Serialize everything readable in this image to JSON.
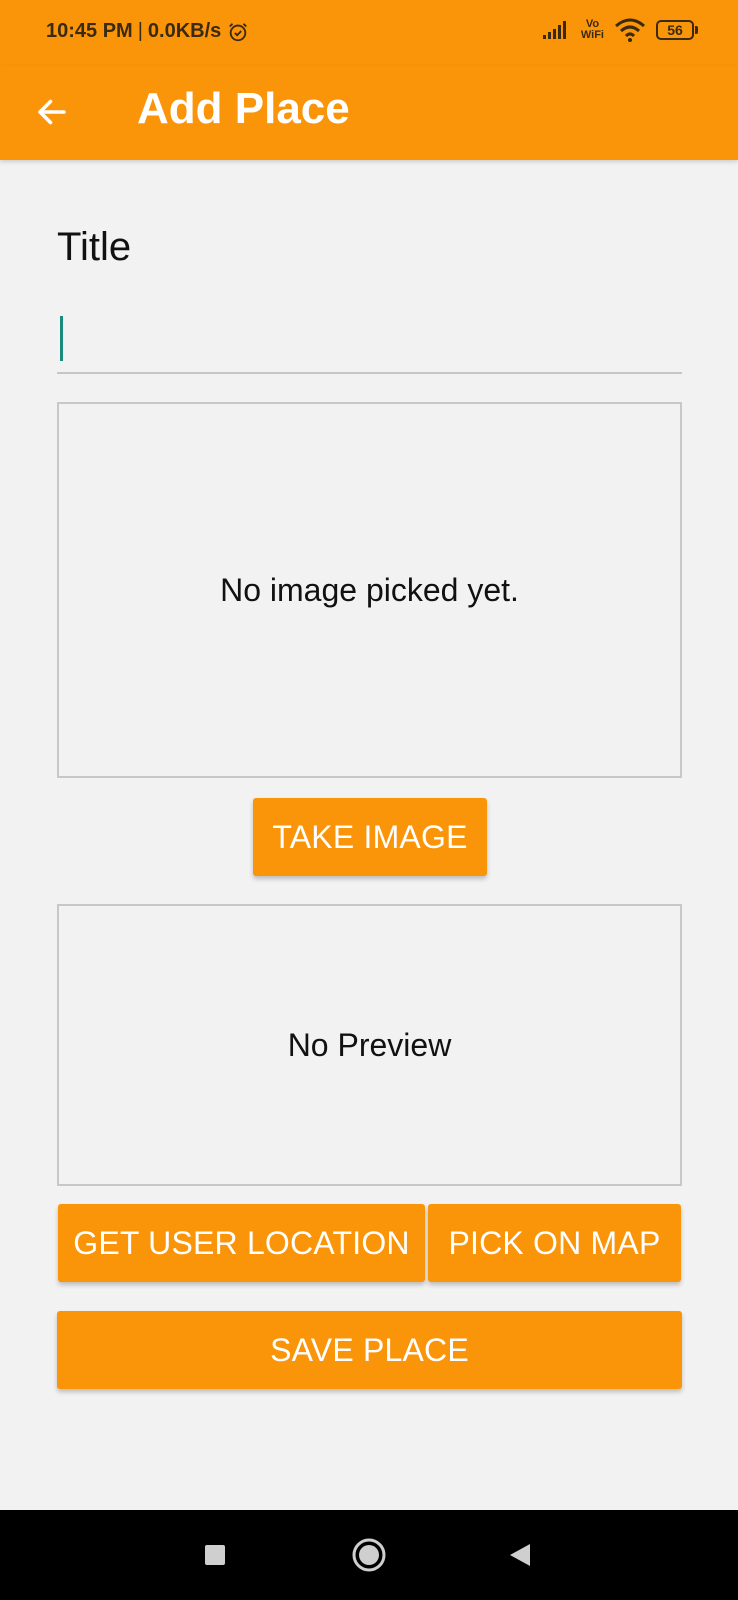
{
  "status_bar": {
    "time": "10:45 PM",
    "separator": "|",
    "network_speed": "0.0KB/s",
    "vowifi_top": "Vo",
    "vowifi_bottom": "WiFi",
    "battery": "56",
    "icons": [
      "alarm-icon",
      "signal-icon",
      "wifi-icon",
      "battery-icon"
    ]
  },
  "app_bar": {
    "title": "Add Place",
    "back_icon": "arrow-left-icon"
  },
  "form": {
    "title_label": "Title",
    "title_value": "",
    "image_placeholder": "No image picked yet.",
    "take_image_label": "TAKE IMAGE",
    "location_placeholder": "No Preview",
    "get_user_location_label": "GET USER LOCATION",
    "pick_on_map_label": "PICK ON MAP",
    "save_place_label": "SAVE PLACE"
  },
  "nav_bar": {
    "icons": [
      "recents-icon",
      "home-icon",
      "back-icon"
    ]
  },
  "colors": {
    "accent": "#fa9409",
    "background": "#f2f2f2",
    "caret": "#1a8a7a"
  }
}
